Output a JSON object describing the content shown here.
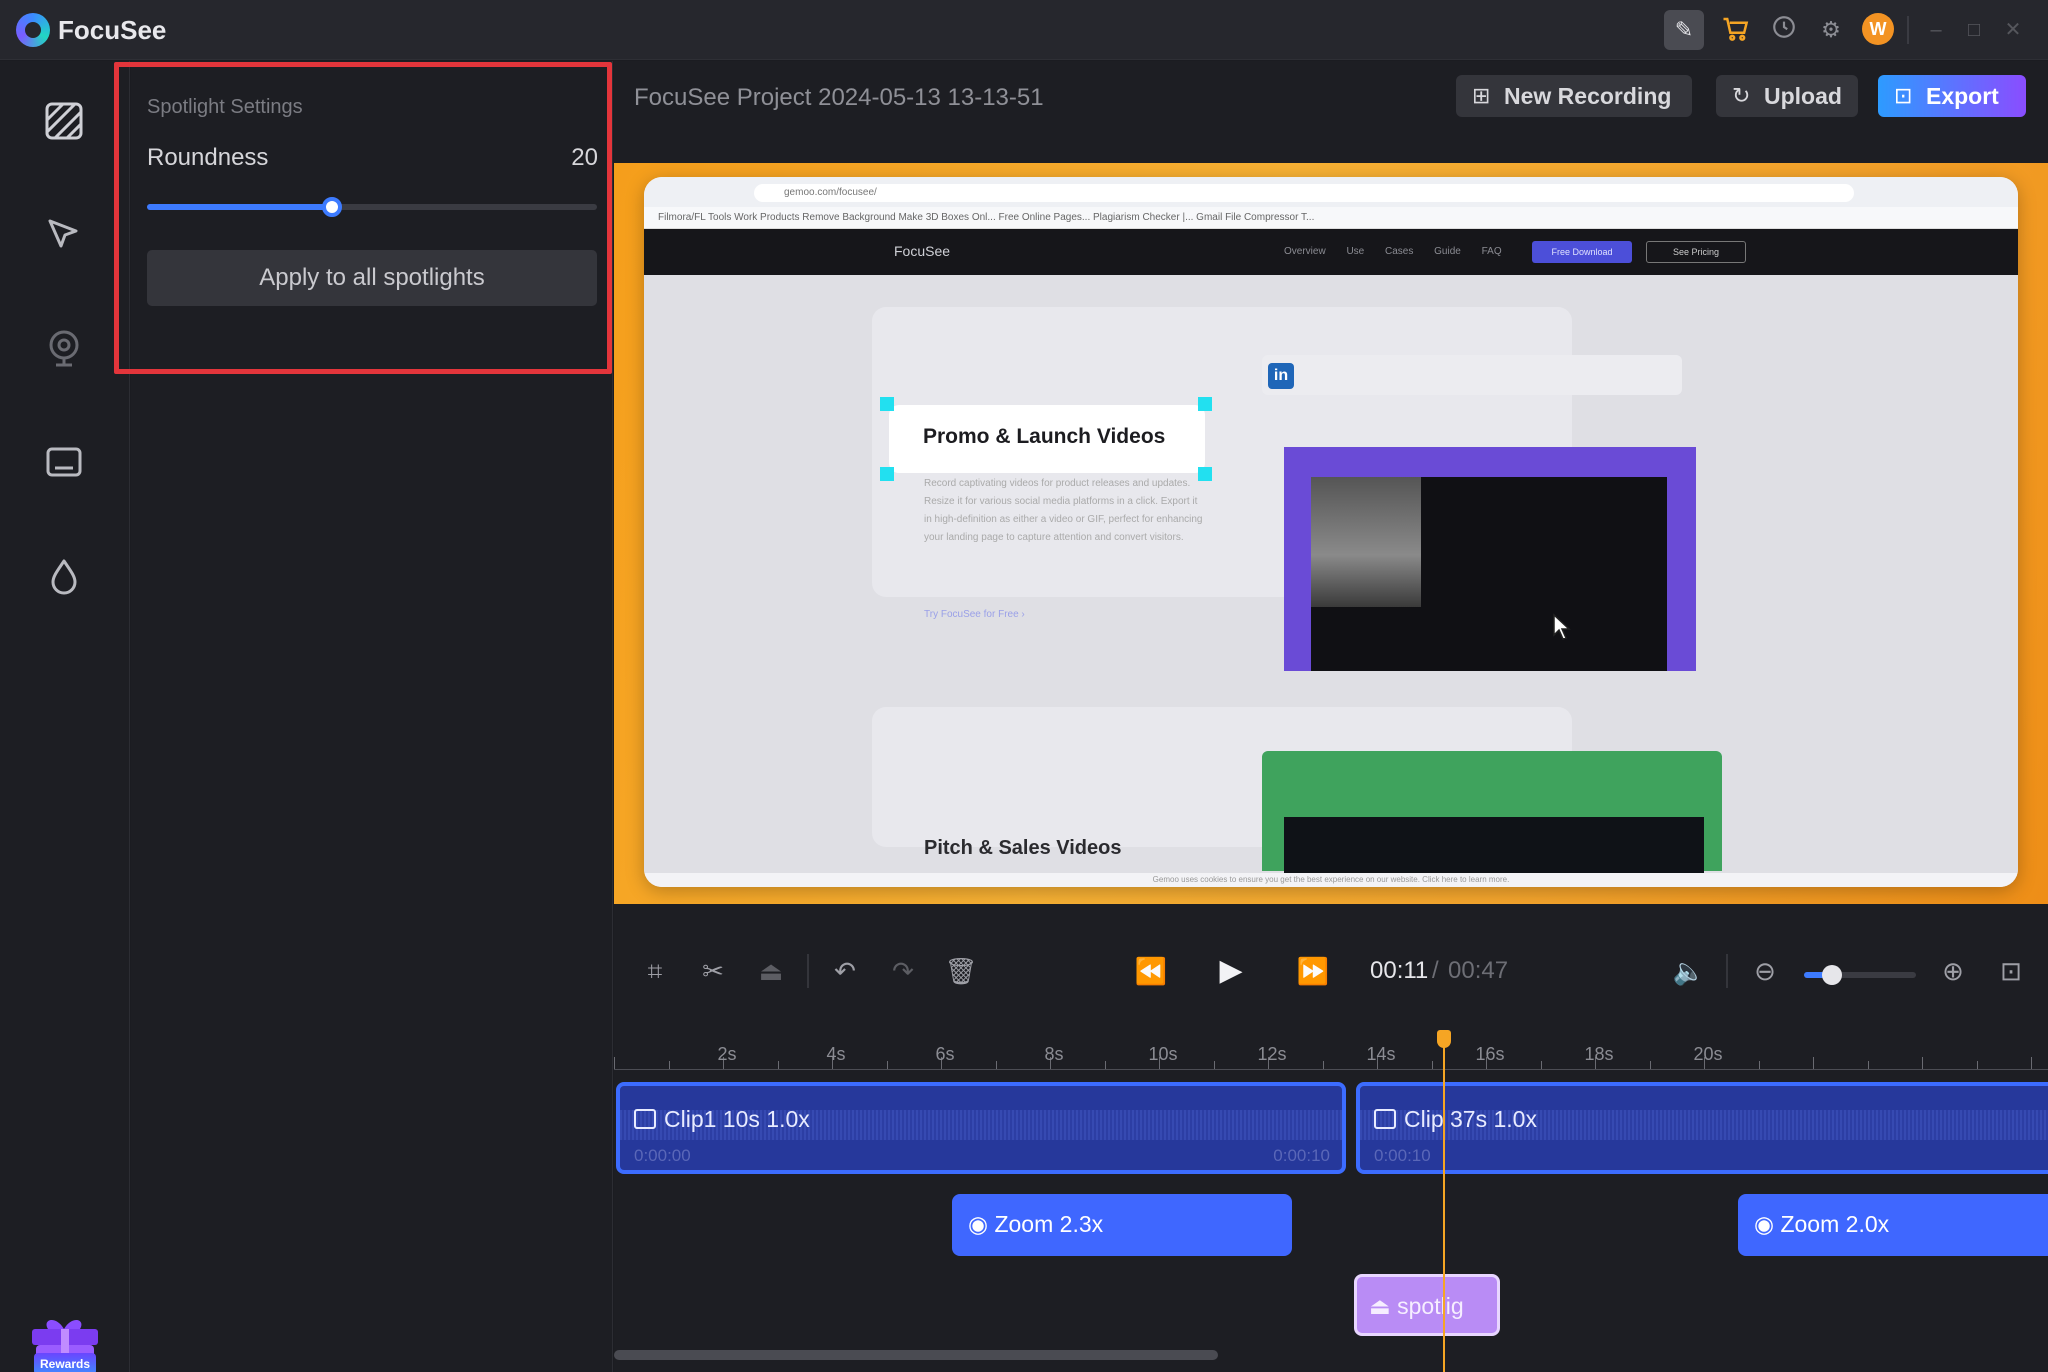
{
  "app": {
    "name": "FocuSee",
    "title_icons": [
      "edit-icon",
      "cart-icon",
      "history-icon",
      "settings-icon"
    ],
    "avatar_letter": "W",
    "window_controls": {
      "minimize": "–",
      "maximize": "□",
      "close": "✕"
    }
  },
  "rail": {
    "tools": [
      "background-icon",
      "cursor-icon",
      "camera-icon",
      "caption-icon",
      "watermark-icon"
    ],
    "rewards_label": "Rewards"
  },
  "spotlight_settings": {
    "title": "Spotlight Settings",
    "roundness_label": "Roundness",
    "roundness_value": "20",
    "roundness_fraction": 0.41,
    "apply_button": "Apply to all spotlights"
  },
  "header": {
    "project_title": "FocuSee Project 2024-05-13 13-13-51",
    "new_recording": "New Recording",
    "upload": "Upload",
    "export": "Export"
  },
  "preview": {
    "address": "gemoo.com/focusee/",
    "bookmarks": "Filmora/FL Tools   Work   Products   Remove Background   Make 3D Boxes Onl...   Free Online Pages...   Plagiarism Checker |...   Gmail   File Compressor T...",
    "site_logo": "FocuSee",
    "site_links": "Overview Use Cases Guide FAQ",
    "free_download": "Free Download",
    "see_pricing": "See Pricing",
    "card_body": "Record captivating videos for product releases and updates. Resize it for various social media platforms in a click. Export it in high-definition as either a video or GIF, perfect for enhancing your landing page to capture attention and convert visitors.",
    "try_link": "Try FocuSee for Free ›",
    "linkedin": "in",
    "spotlight_text": "Promo & Launch Videos",
    "pitch_title": "Pitch & Sales Videos",
    "cookie_notice": "Gemoo uses cookies to ensure you get the best experience on our website. Click here to learn more."
  },
  "controls": {
    "time_current": "00:11",
    "time_separator": "/",
    "time_total": "00:47",
    "zoom_fraction": 0.25
  },
  "timeline": {
    "ruler_labels": [
      "2s",
      "4s",
      "6s",
      "8s",
      "10s",
      "12s",
      "14s",
      "16s",
      "18s",
      "20s"
    ],
    "clips": [
      {
        "label": "Clip1   10s     1.0x",
        "start": "0:00:00",
        "end": "0:00:10"
      },
      {
        "label": "Clip   37s     1.0x",
        "start": "0:00:10"
      }
    ],
    "zooms": [
      {
        "label": "Zoom   2.3x"
      },
      {
        "label": "Zoom   2.0x"
      }
    ],
    "spotlight_label": "spotlig"
  }
}
